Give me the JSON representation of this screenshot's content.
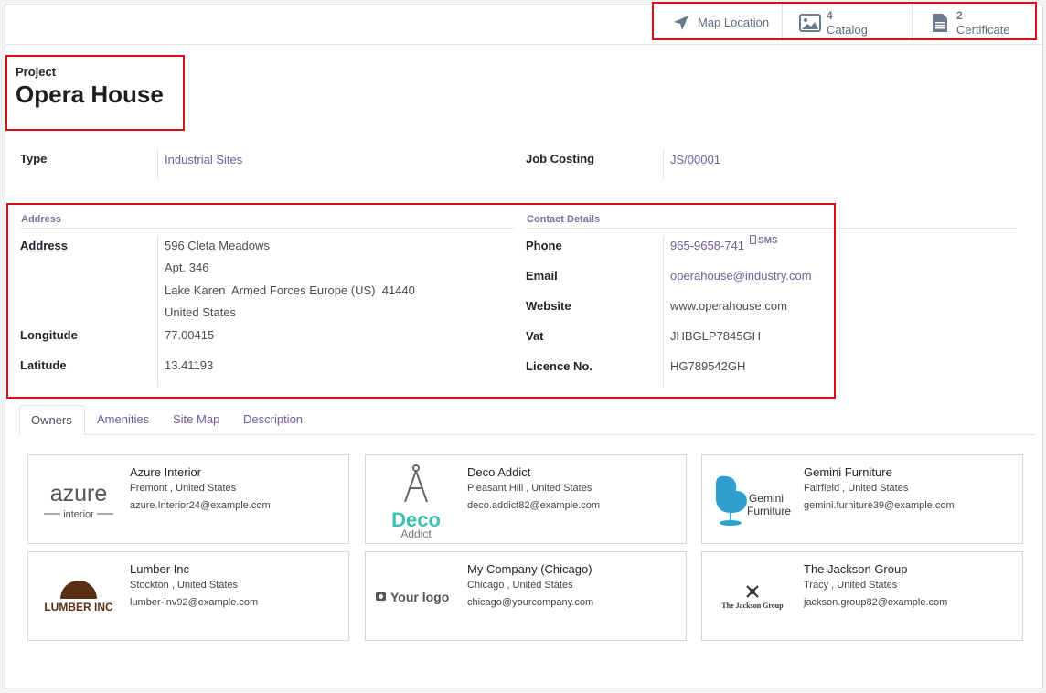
{
  "smart_buttons": {
    "map": {
      "label": "Map Location",
      "icon": "location-arrow-icon"
    },
    "catalog": {
      "count": "4",
      "label": "Catalog",
      "icon": "image-icon"
    },
    "certificate": {
      "count": "2",
      "label": "Certificate",
      "icon": "document-icon"
    }
  },
  "header": {
    "label": "Project",
    "name": "Opera House"
  },
  "general": {
    "type_label": "Type",
    "type_value": "Industrial Sites",
    "job_costing_label": "Job Costing",
    "job_costing_value": "JS/00001"
  },
  "address_section": {
    "title": "Address",
    "address_label": "Address",
    "address_lines": [
      "596 Cleta Meadows",
      "Apt. 346",
      "Lake Karen  Armed Forces Europe (US)  41440",
      "United States"
    ],
    "longitude_label": "Longitude",
    "longitude_value": "77.00415",
    "latitude_label": "Latitude",
    "latitude_value": "13.41193"
  },
  "contact_section": {
    "title": "Contact Details",
    "phone_label": "Phone",
    "phone_value": "965-9658-741",
    "sms_label": "SMS",
    "email_label": "Email",
    "email_value": "operahouse@industry.com",
    "website_label": "Website",
    "website_value": "www.operahouse.com",
    "vat_label": "Vat",
    "vat_value": "JHBGLP7845GH",
    "licence_label": "Licence No.",
    "licence_value": "HG789542GH"
  },
  "tabs": [
    "Owners",
    "Amenities",
    "Site Map",
    "Description"
  ],
  "owners": [
    {
      "name": "Azure Interior",
      "location": "Fremont , United States",
      "email": "azure.Interior24@example.com",
      "logo_text": [
        "azure",
        "interior"
      ]
    },
    {
      "name": "Deco Addict",
      "location": "Pleasant Hill , United States",
      "email": "deco.addict82@example.com",
      "logo_text": [
        "Deco",
        "Addict"
      ]
    },
    {
      "name": "Gemini Furniture",
      "location": "Fairfield , United States",
      "email": "gemini.furniture39@example.com",
      "logo_text": [
        "Gemini",
        "Furniture"
      ]
    },
    {
      "name": "Lumber Inc",
      "location": "Stockton , United States",
      "email": "lumber-inv92@example.com",
      "logo_text": [
        "LUMBER INC"
      ]
    },
    {
      "name": "My Company (Chicago)",
      "location": "Chicago , United States",
      "email": "chicago@yourcompany.com",
      "logo_text": [
        "Your logo"
      ]
    },
    {
      "name": "The Jackson Group",
      "location": "Tracy , United States",
      "email": "jackson.group82@example.com",
      "logo_text": [
        "The Jackson Group"
      ]
    }
  ],
  "colors": {
    "accent": "#7c6f9c",
    "highlight_border": "#d40f16"
  }
}
